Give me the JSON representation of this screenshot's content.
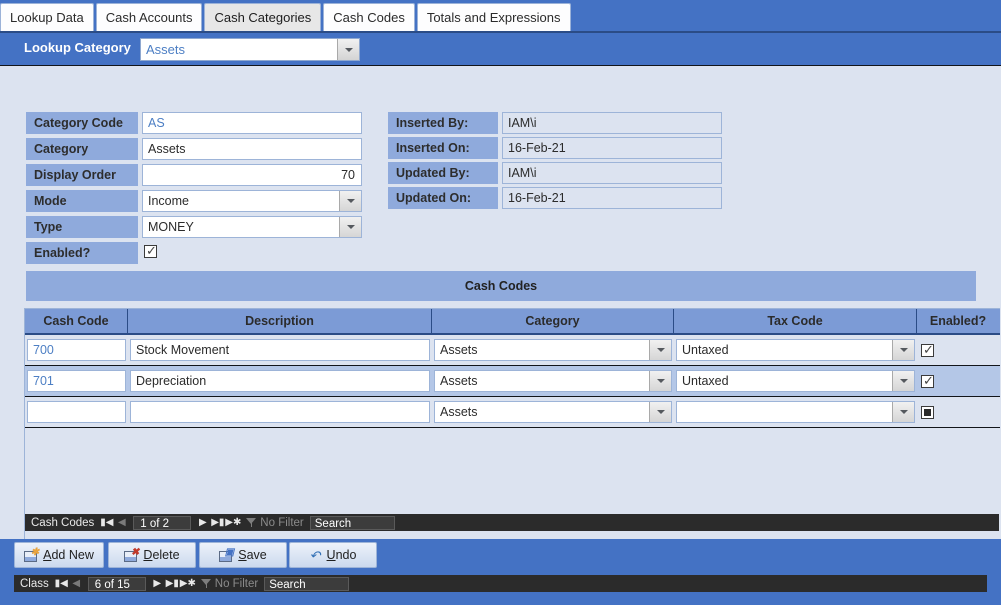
{
  "tabs": [
    {
      "label": "Lookup Data",
      "active": false
    },
    {
      "label": "Cash Accounts",
      "active": false
    },
    {
      "label": "Cash Categories",
      "active": true
    },
    {
      "label": "Cash Codes",
      "active": false
    },
    {
      "label": "Totals and Expressions",
      "active": false
    }
  ],
  "header": {
    "label": "Lookup Category",
    "value": "Assets"
  },
  "form": {
    "left": [
      {
        "label": "Category Code",
        "value": "AS"
      },
      {
        "label": "Category",
        "value": "Assets"
      },
      {
        "label": "Display Order",
        "value": "70"
      },
      {
        "label": "Mode",
        "value": "Income"
      },
      {
        "label": "Type",
        "value": "MONEY"
      },
      {
        "label": "Enabled?",
        "value": ""
      }
    ],
    "right": [
      {
        "label": "Inserted By:",
        "value": "IAM\\i"
      },
      {
        "label": "Inserted On:",
        "value": "16-Feb-21"
      },
      {
        "label": "Updated By:",
        "value": "IAM\\i"
      },
      {
        "label": "Updated On:",
        "value": "16-Feb-21"
      }
    ]
  },
  "subform": {
    "banner": "Cash Codes",
    "columns": [
      "Cash Code",
      "Description",
      "Category",
      "Tax Code",
      "Enabled?"
    ],
    "rows": [
      {
        "code": "700",
        "description": "Stock Movement",
        "category": "Assets",
        "tax_code": "Untaxed",
        "enabled": "checked",
        "selected": false
      },
      {
        "code": "701",
        "description": "Depreciation",
        "category": "Assets",
        "tax_code": "Untaxed",
        "enabled": "checked",
        "selected": true
      },
      {
        "code": "",
        "description": "",
        "category": "Assets",
        "tax_code": "",
        "enabled": "null",
        "selected": false
      }
    ],
    "nav": {
      "label": "Cash Codes",
      "position": "1 of 2",
      "filter": "No Filter",
      "search": "Search"
    }
  },
  "buttons": [
    {
      "id": "add-new",
      "pre": "",
      "key": "A",
      "post": "dd New"
    },
    {
      "id": "delete",
      "pre": "",
      "key": "D",
      "post": "elete"
    },
    {
      "id": "save",
      "pre": "",
      "key": "S",
      "post": "ave"
    },
    {
      "id": "undo",
      "pre": "",
      "key": "U",
      "post": "ndo"
    }
  ],
  "status": {
    "label": "Class",
    "position": "6 of 15",
    "filter": "No Filter",
    "search": "Search"
  },
  "colors": {
    "accent": "#4472C4",
    "panel_bg": "#DCE3F0",
    "label_bg": "#8FAADC",
    "row_selected": "#B4C7E7",
    "header_text": "#FFFFFF",
    "link_value": "#4D7FC4",
    "navbar_bg": "#2B2B2B"
  }
}
